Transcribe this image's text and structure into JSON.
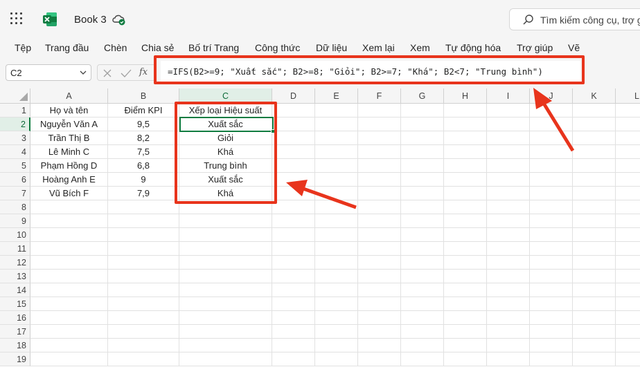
{
  "app": {
    "title": "Book 3",
    "search_placeholder": "Tìm kiếm công cụ, trợ g",
    "accent_color": "#107c41",
    "annotation_color": "#e8341c"
  },
  "menu": [
    "Tệp",
    "Trang đầu",
    "Chèn",
    "Chia sẻ",
    "Bố trí Trang",
    "Công thức",
    "Dữ liệu",
    "Xem lại",
    "Xem",
    "Tự động hóa",
    "Trợ giúp",
    "Vẽ"
  ],
  "formula_bar": {
    "name_box": "C2",
    "fx_label": "fx",
    "formula": "=IFS(B2>=9; \"Xuất sắc\"; B2>=8; \"Giỏi\"; B2>=7; \"Khá\"; B2<7; \"Trung bình\")"
  },
  "grid": {
    "columns": [
      "A",
      "B",
      "C",
      "D",
      "E",
      "F",
      "G",
      "H",
      "I",
      "J",
      "K",
      "L"
    ],
    "rows": [
      "1",
      "2",
      "3",
      "4",
      "5",
      "6",
      "7",
      "8",
      "9",
      "10",
      "11",
      "12",
      "13",
      "14",
      "15",
      "16",
      "17",
      "18",
      "19"
    ],
    "selected_cell": "C2",
    "data": [
      [
        "Họ và tên",
        "Điểm KPI",
        "Xếp loại Hiệu suất"
      ],
      [
        "Nguyễn Văn A",
        "9,5",
        "Xuất sắc"
      ],
      [
        "Trần Thị B",
        "8,2",
        "Giỏi"
      ],
      [
        "Lê Minh C",
        "7,5",
        "Khá"
      ],
      [
        "Phạm Hồng D",
        "6,8",
        "Trung bình"
      ],
      [
        "Hoàng Anh E",
        "9",
        "Xuất sắc"
      ],
      [
        "Vũ Bích F",
        "7,9",
        "Khá"
      ]
    ]
  }
}
